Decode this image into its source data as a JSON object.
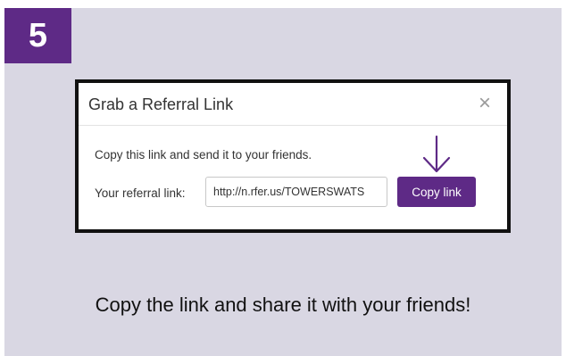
{
  "step": {
    "number": "5"
  },
  "dialog": {
    "title": "Grab a Referral Link",
    "close_symbol": "×",
    "instruction": "Copy this link and send it to your friends.",
    "link_label": "Your referral link:",
    "link_value": "http://n.rfer.us/TOWERSWATS",
    "copy_button_label": "Copy link",
    "arrow_icon": "arrow-down-icon"
  },
  "caption": "Copy the link and share it with your friends!",
  "colors": {
    "accent": "#5e2a86",
    "background": "#d9d7e3",
    "dialog_border": "#111111"
  }
}
